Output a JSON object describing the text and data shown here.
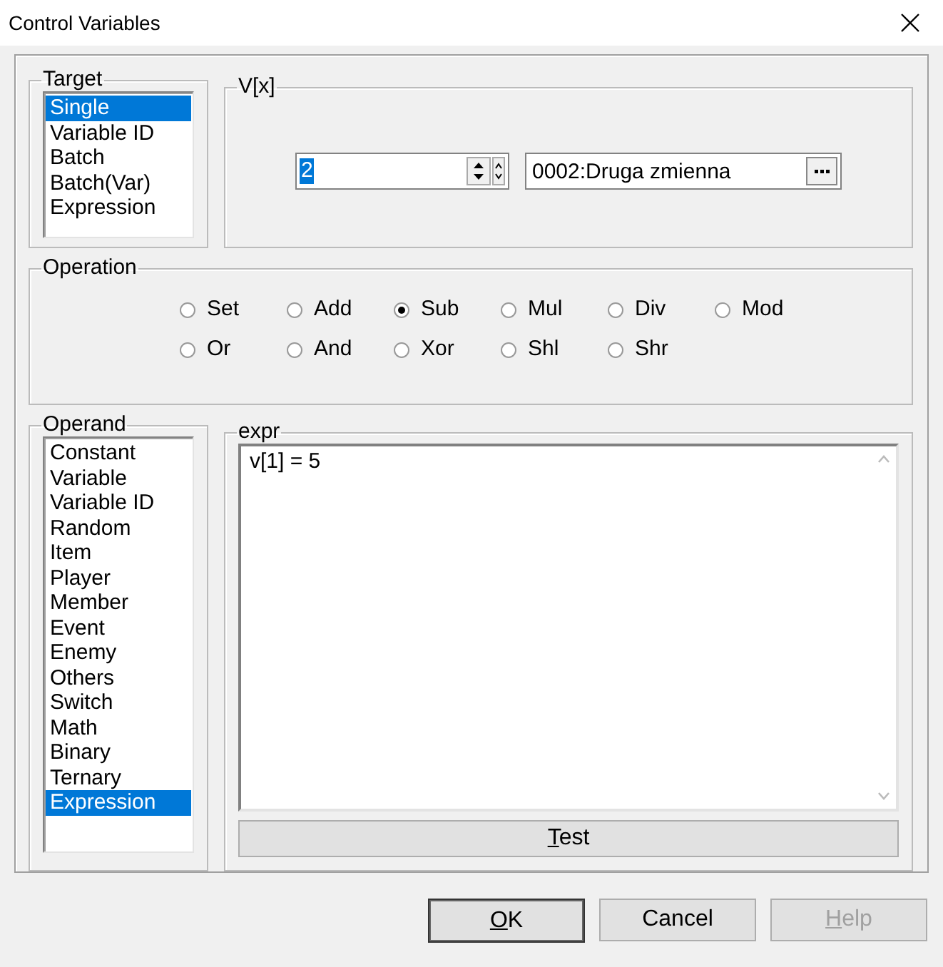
{
  "window": {
    "title": "Control Variables"
  },
  "target": {
    "title": "Target",
    "items": [
      {
        "label": "Single",
        "selected": true
      },
      {
        "label": "Variable ID",
        "selected": false
      },
      {
        "label": "Batch",
        "selected": false
      },
      {
        "label": "Batch(Var)",
        "selected": false
      },
      {
        "label": "Expression",
        "selected": false
      }
    ]
  },
  "variable": {
    "title": "V[x]",
    "number": "2",
    "name": "0002:Druga zmienna"
  },
  "operation": {
    "title": "Operation",
    "rows": [
      [
        {
          "label": "Set",
          "selected": false
        },
        {
          "label": "Add",
          "selected": false
        },
        {
          "label": "Sub",
          "selected": true
        },
        {
          "label": "Mul",
          "selected": false
        },
        {
          "label": "Div",
          "selected": false
        },
        {
          "label": "Mod",
          "selected": false
        }
      ],
      [
        {
          "label": "Or",
          "selected": false
        },
        {
          "label": "And",
          "selected": false
        },
        {
          "label": "Xor",
          "selected": false
        },
        {
          "label": "Shl",
          "selected": false
        },
        {
          "label": "Shr",
          "selected": false
        }
      ]
    ]
  },
  "operand": {
    "title": "Operand",
    "items": [
      {
        "label": "Constant",
        "selected": false
      },
      {
        "label": "Variable",
        "selected": false
      },
      {
        "label": "Variable ID",
        "selected": false
      },
      {
        "label": "Random",
        "selected": false
      },
      {
        "label": "Item",
        "selected": false
      },
      {
        "label": "Player",
        "selected": false
      },
      {
        "label": "Member",
        "selected": false
      },
      {
        "label": "Event",
        "selected": false
      },
      {
        "label": "Enemy",
        "selected": false
      },
      {
        "label": "Others",
        "selected": false
      },
      {
        "label": "Switch",
        "selected": false
      },
      {
        "label": "Math",
        "selected": false
      },
      {
        "label": "Binary",
        "selected": false
      },
      {
        "label": "Ternary",
        "selected": false
      },
      {
        "label": "Expression",
        "selected": true
      }
    ]
  },
  "expr": {
    "title": "expr",
    "value": "v[1] = 5",
    "test_button": {
      "label": "Test",
      "mnemonic": true
    }
  },
  "buttons": [
    {
      "label": "OK",
      "mnemonic": true,
      "disabled": false,
      "default": true
    },
    {
      "label": "Cancel",
      "mnemonic": false,
      "disabled": false,
      "default": false
    },
    {
      "label": "Help",
      "mnemonic": true,
      "disabled": true,
      "default": false
    }
  ]
}
